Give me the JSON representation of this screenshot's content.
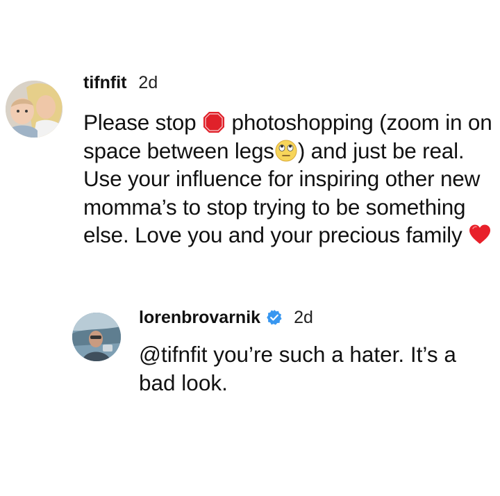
{
  "main_comment": {
    "username": "tifnfit",
    "time": "2d",
    "text_part1": "Please stop ",
    "emoji1": "stop-sign-icon",
    "text_part2": " photoshopping (zoom in on space between legs",
    "emoji2": "eye-roll-face-icon",
    "text_part3": ") and just be real. Use your influence for inspiring other new momma’s to stop trying to be something else. Love you and your precious family ",
    "emoji3": "red-heart-icon"
  },
  "reply": {
    "username": "lorenbrovarnik",
    "verified": true,
    "time": "2d",
    "text": "@tifnfit you’re such a hater. It’s a bad look."
  },
  "colors": {
    "text": "#111111",
    "verified_blue": "#3897f0",
    "stop_red": "#e0212a",
    "heart_red": "#e8202a"
  }
}
